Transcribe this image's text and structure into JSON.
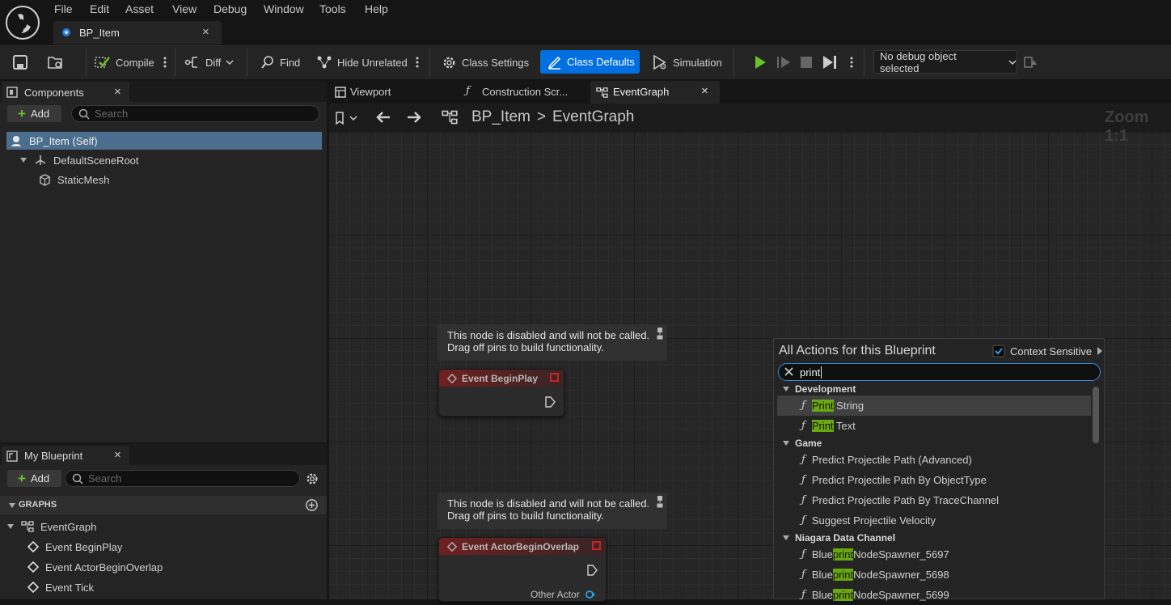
{
  "menu": [
    "File",
    "Edit",
    "Asset",
    "View",
    "Debug",
    "Window",
    "Tools",
    "Help"
  ],
  "doc_tab": {
    "label": "BP_Item",
    "close": "×"
  },
  "toolbar": {
    "compile": "Compile",
    "diff": "Diff",
    "find": "Find",
    "hide_unrelated": "Hide Unrelated",
    "class_settings": "Class Settings",
    "class_defaults": "Class Defaults",
    "simulation": "Simulation",
    "debug_object": "No debug object selected"
  },
  "components": {
    "tab": "Components",
    "add": "Add",
    "search_placeholder": "Search",
    "tree": [
      "BP_Item (Self)",
      "DefaultSceneRoot",
      "StaticMesh"
    ]
  },
  "my_blueprint": {
    "tab": "My Blueprint",
    "add": "Add",
    "search_placeholder": "Search",
    "graphs_header": "GRAPHS",
    "graph_name": "EventGraph",
    "events": [
      "Event BeginPlay",
      "Event ActorBeginOverlap",
      "Event Tick"
    ]
  },
  "editor_tabs": [
    "Viewport",
    "Construction Scr...",
    "EventGraph"
  ],
  "breadcrumb": {
    "root": "BP_Item",
    "sep": ">",
    "graph": "EventGraph"
  },
  "zoom": "Zoom 1:1",
  "comments": [
    {
      "line1": "This node is disabled and will not be called.",
      "line2": "Drag off pins to build functionality."
    },
    {
      "line1": "This node is disabled and will not be called.",
      "line2": "Drag off pins to build functionality."
    }
  ],
  "nodes": [
    {
      "title": "Event BeginPlay"
    },
    {
      "title": "Event ActorBeginOverlap",
      "pin": "Other Actor"
    }
  ],
  "actions": {
    "title": "All Actions for this Blueprint",
    "context_sensitive": "Context Sensitive",
    "context_checked": true,
    "query": "print",
    "categories": [
      {
        "name": "Development",
        "items": [
          {
            "pre": "",
            "hl": "Print",
            "post": " String",
            "selected": true
          },
          {
            "pre": "",
            "hl": "Print",
            "post": " Text"
          }
        ]
      },
      {
        "name": "Game",
        "items": [
          {
            "pre": "Predict Projectile Path (Advanced)",
            "hl": "",
            "post": ""
          },
          {
            "pre": "Predict Projectile Path By ObjectType",
            "hl": "",
            "post": ""
          },
          {
            "pre": "Predict Projectile Path By TraceChannel",
            "hl": "",
            "post": ""
          },
          {
            "pre": "Suggest Projectile Velocity",
            "hl": "",
            "post": ""
          }
        ]
      },
      {
        "name": "Niagara Data Channel",
        "items": [
          {
            "pre": "Blue",
            "hl": "print",
            "post": "NodeSpawner_5697"
          },
          {
            "pre": "Blue",
            "hl": "print",
            "post": "NodeSpawner_5698"
          },
          {
            "pre": "Blue",
            "hl": "print",
            "post": "NodeSpawner_5699"
          }
        ]
      }
    ]
  },
  "colors": {
    "accent": "#0070e0",
    "highlight": "#6aa812",
    "play": "#6bc02a",
    "event_header": "#6e2020"
  }
}
